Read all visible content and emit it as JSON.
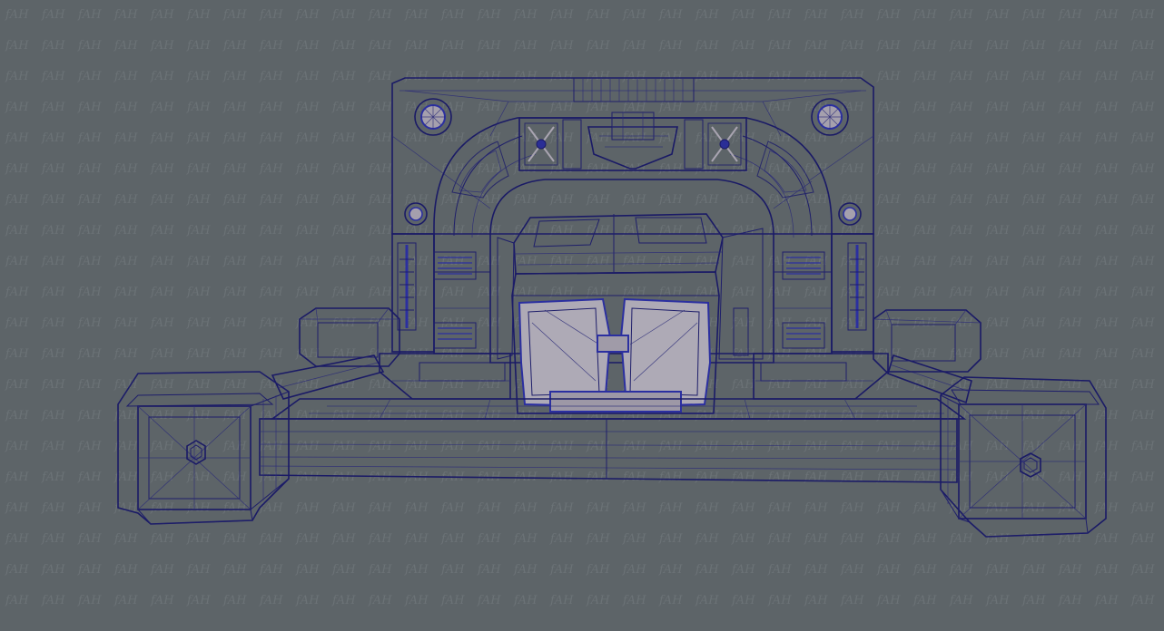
{
  "viewport": {
    "background_color": "#5d6468",
    "watermark_text": "fAH",
    "watermark_color": "#6b7276"
  },
  "model": {
    "subject": "sci-fi gate structure wireframe",
    "surface_color": "#a9a4ae",
    "surface_dark_color": "#8f8b96",
    "wire_color": "#1e1e6a",
    "accent_color": "#2b2fa0"
  }
}
